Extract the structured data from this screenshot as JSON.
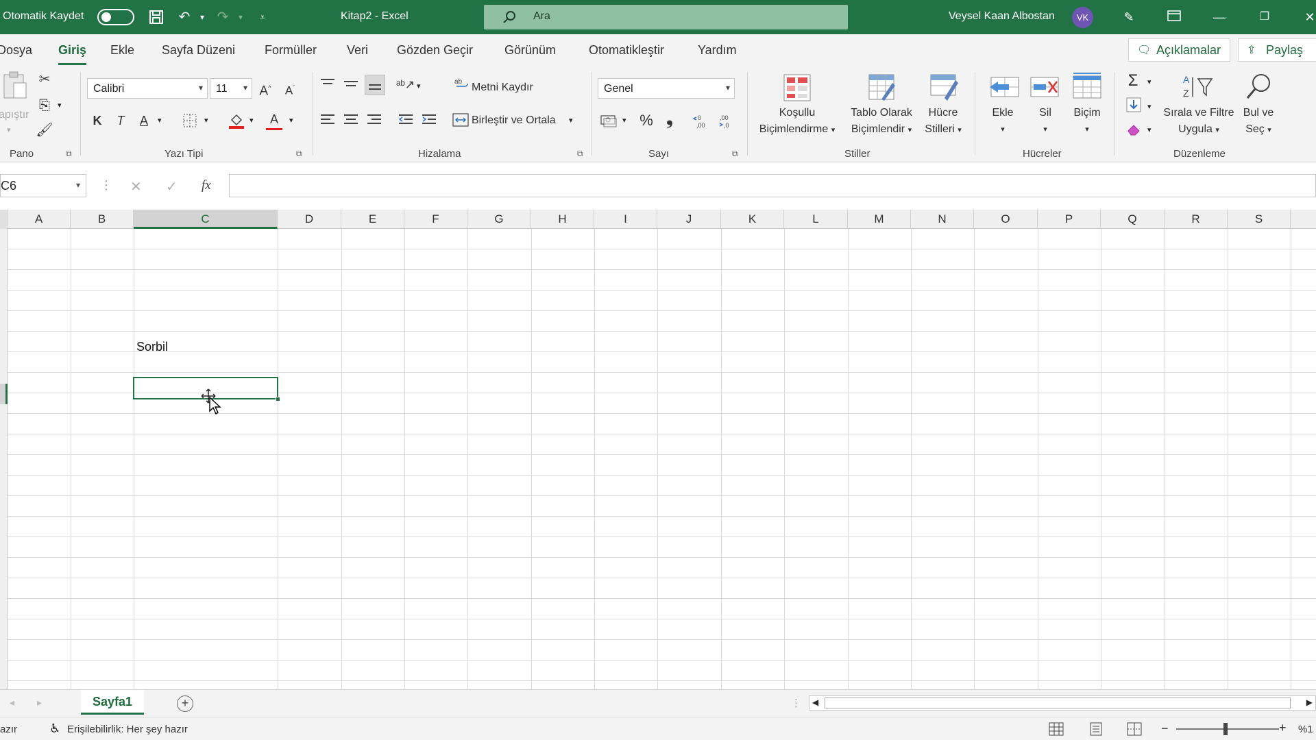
{
  "titlebar": {
    "autosave_label": "Otomatik Kaydet",
    "title": "Kitap2  -  Excel",
    "search_placeholder": "Ara",
    "user_name": "Veysel Kaan Albostan",
    "user_initials": "VK"
  },
  "tabs": [
    "Dosya",
    "Giriş",
    "Ekle",
    "Sayfa Düzeni",
    "Formüller",
    "Veri",
    "Gözden Geçir",
    "Görünüm",
    "Otomatikleştir",
    "Yardım"
  ],
  "active_tab": "Giriş",
  "ribbon_right": {
    "comments": "Açıklamalar",
    "share": "Paylaş"
  },
  "ribbon": {
    "pano": {
      "paste": "apıştır",
      "label": "Pano"
    },
    "font": {
      "name": "Calibri",
      "size": "11",
      "bold": "K",
      "italic": "T",
      "underline": "A",
      "color_letter": "A",
      "label": "Yazı Tipi"
    },
    "alignment": {
      "wrap": "Metni Kaydır",
      "merge": "Birleştir ve Ortala",
      "label": "Hizalama"
    },
    "number": {
      "format": "Genel",
      "percent": "%",
      "comma": "❟",
      "label": "Sayı"
    },
    "styles": {
      "conditional": [
        "Koşullu",
        "Biçimlendirme"
      ],
      "table": [
        "Tablo Olarak",
        "Biçimlendir"
      ],
      "cell": [
        "Hücre",
        "Stilleri"
      ],
      "label": "Stiller"
    },
    "cells": {
      "insert": "Ekle",
      "delete": "Sil",
      "format": "Biçim",
      "label": "Hücreler"
    },
    "editing": {
      "sort": [
        "Sırala ve Filtre",
        "Uygula"
      ],
      "find": [
        "Bul ve",
        "Seç"
      ],
      "label": "Düzenleme"
    }
  },
  "formula_bar": {
    "name_box": "C6",
    "fx": "fx",
    "value": ""
  },
  "columns": [
    "A",
    "B",
    "C",
    "D",
    "E",
    "F",
    "G",
    "H",
    "I",
    "J",
    "K",
    "L",
    "M",
    "N",
    "O",
    "P",
    "Q",
    "R",
    "S"
  ],
  "selected_column": "C",
  "cells": {
    "C5": "Sorbil"
  },
  "sheets": [
    "Sayfa1"
  ],
  "status": {
    "ready": "azır",
    "accessibility": "Erişilebilirlik: Her şey hazır",
    "zoom": "%1"
  },
  "colors": {
    "accent": "#217346",
    "titlebar": "#217346",
    "ribbon_bg": "#f3f3f3"
  }
}
